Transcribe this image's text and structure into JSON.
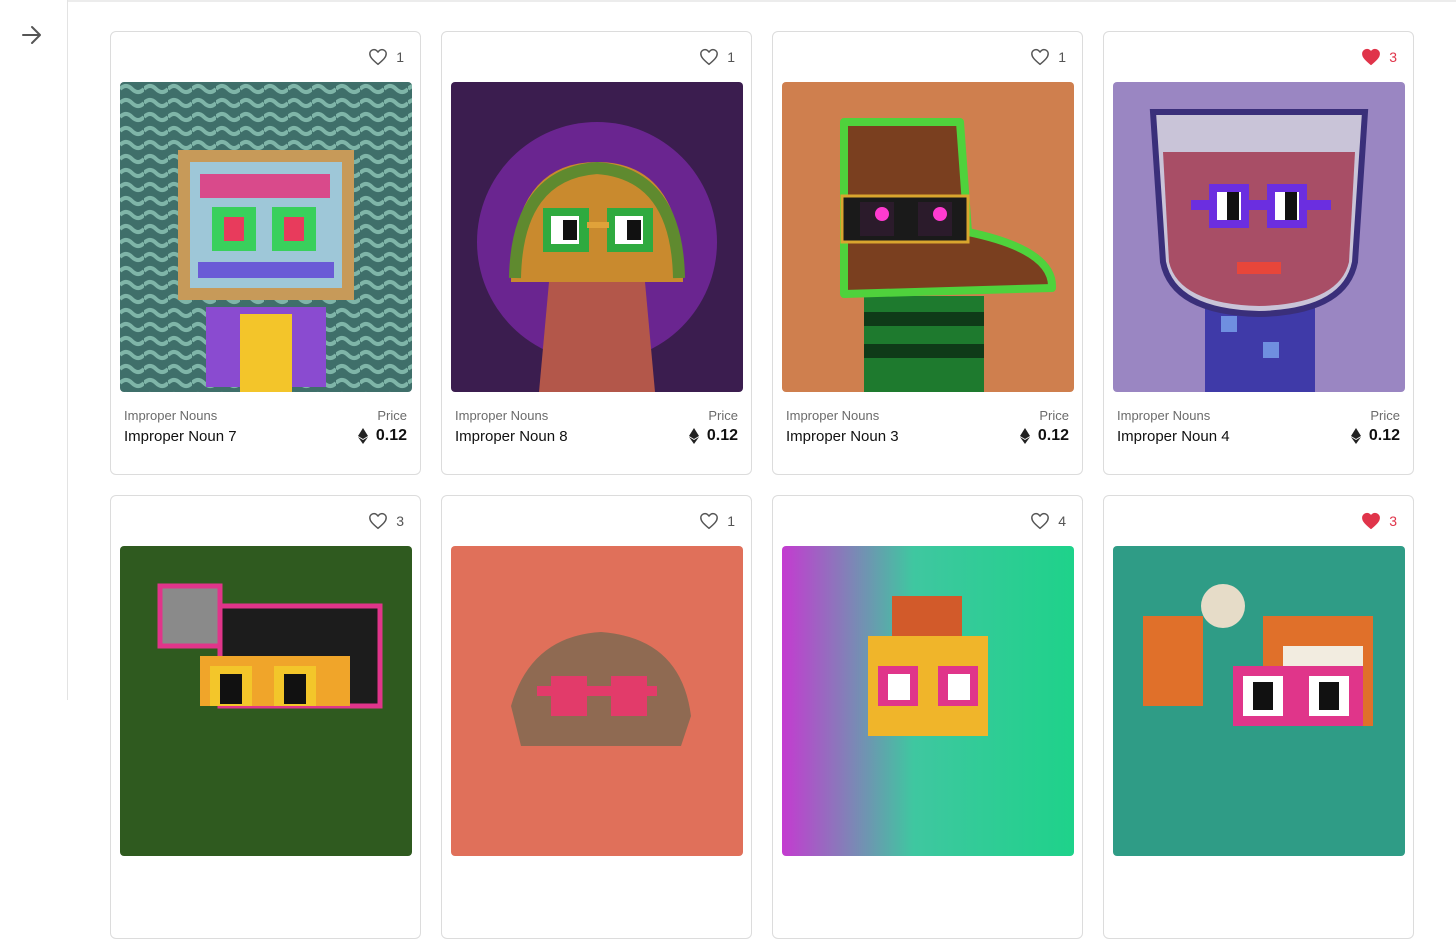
{
  "sidebar": {
    "toggle_icon": "arrow-right-icon"
  },
  "labels": {
    "price": "Price"
  },
  "colors": {
    "liked": "#e0344a",
    "unliked_stroke": "#555555"
  },
  "cards": [
    {
      "collection": "Improper Nouns",
      "name": "Improper Noun 7",
      "price": "0.12",
      "likes": "1",
      "liked": false,
      "art": "glitch-tv-noun"
    },
    {
      "collection": "Improper Nouns",
      "name": "Improper Noun 8",
      "price": "0.12",
      "likes": "1",
      "liked": false,
      "art": "taco-noun"
    },
    {
      "collection": "Improper Nouns",
      "name": "Improper Noun 3",
      "price": "0.12",
      "likes": "1",
      "liked": false,
      "art": "boot-noun"
    },
    {
      "collection": "Improper Nouns",
      "name": "Improper Noun 4",
      "price": "0.12",
      "likes": "3",
      "liked": true,
      "art": "glass-noun"
    },
    {
      "likes": "3",
      "liked": false,
      "art": "hedgehog-noun"
    },
    {
      "likes": "1",
      "liked": false,
      "art": "rock-noun"
    },
    {
      "likes": "4",
      "liked": false,
      "art": "pineapple-noun"
    },
    {
      "likes": "3",
      "liked": true,
      "art": "fox-noun"
    }
  ]
}
